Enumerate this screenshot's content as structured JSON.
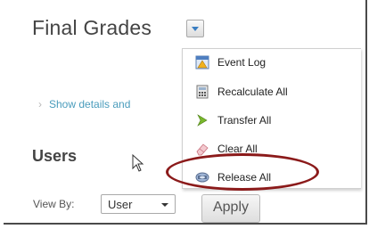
{
  "header": {
    "title": "Final Grades"
  },
  "menu": {
    "items": [
      {
        "label": "Event Log",
        "icon": "event-log-icon"
      },
      {
        "label": "Recalculate All",
        "icon": "calculator-icon"
      },
      {
        "label": "Transfer All",
        "icon": "transfer-arrow-icon"
      },
      {
        "label": "Clear All",
        "icon": "eraser-icon"
      },
      {
        "label": "Release All",
        "icon": "release-icon"
      }
    ]
  },
  "details_link": "Show details and",
  "users": {
    "title": "Users",
    "view_by_label": "View By:",
    "view_by_value": "User",
    "apply_label": "Apply"
  },
  "colors": {
    "accent": "#3a7ec2",
    "link": "#4a9cbc",
    "highlight": "#8b1a1a"
  }
}
